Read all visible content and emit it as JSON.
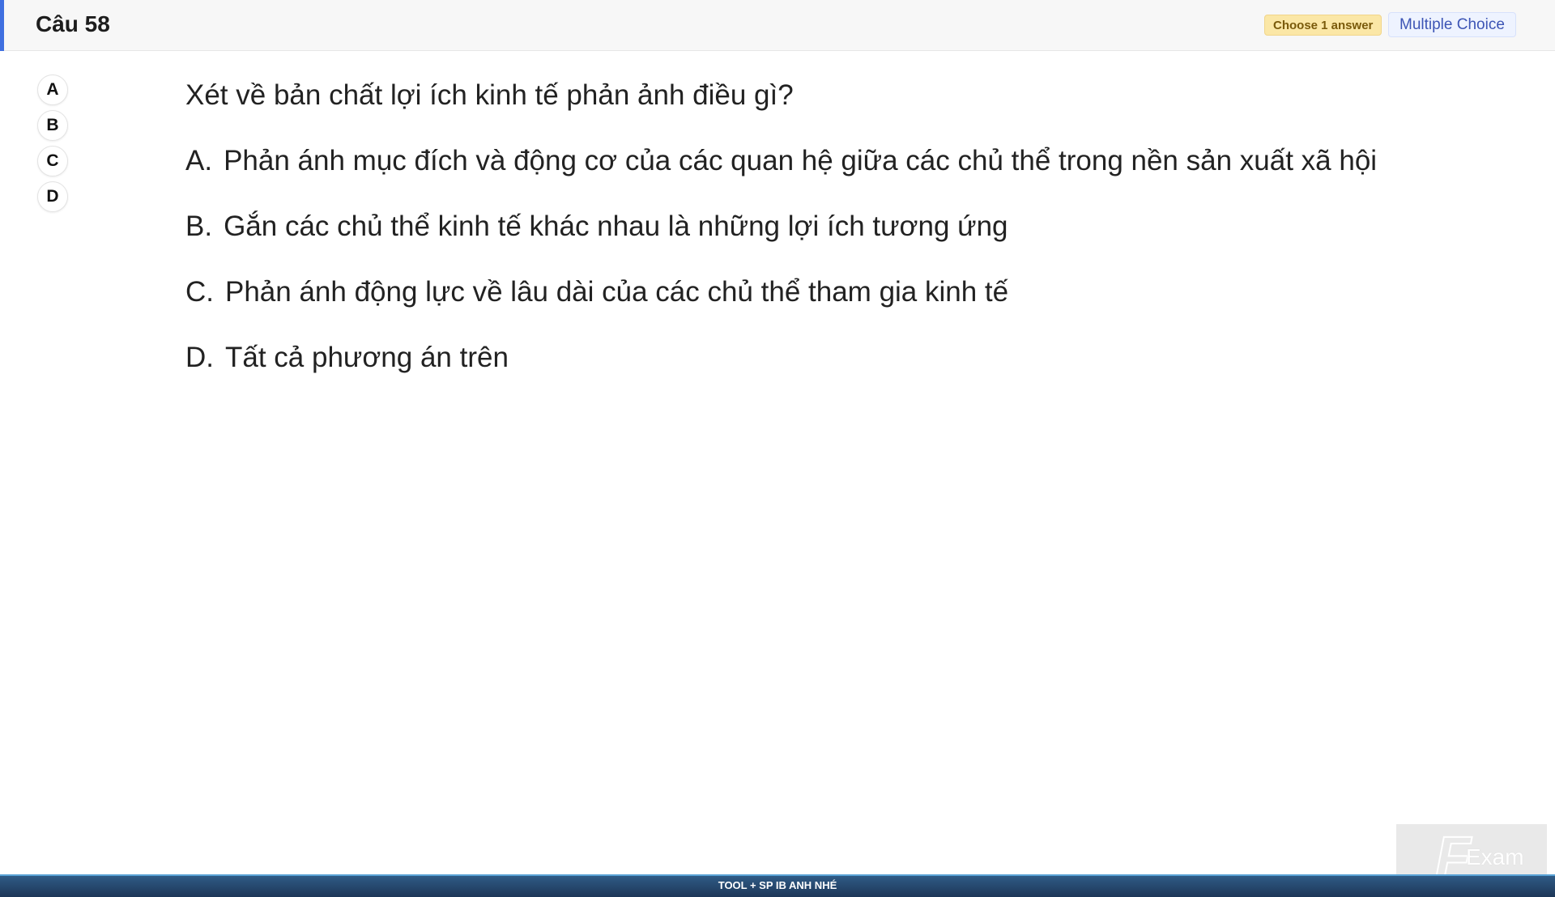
{
  "header": {
    "title": "Câu 58",
    "badge_choose": "Choose 1 answer",
    "badge_type": "Multiple Choice"
  },
  "answer_buttons": [
    "A",
    "B",
    "C",
    "D"
  ],
  "question": {
    "text": "Xét về bản chất lợi ích kinh tế phản ảnh điều gì?",
    "options": [
      {
        "letter": "A.",
        "text": "Phản ánh mục đích và động cơ của các quan hệ giữa các chủ thể trong nền sản xuất xã hội"
      },
      {
        "letter": "B.",
        "text": "Gắn các chủ thể kinh tế khác nhau là những lợi ích tương ứng"
      },
      {
        "letter": "C.",
        "text": "Phản ánh động lực về lâu dài của các chủ thể tham gia kinh tế"
      },
      {
        "letter": "D.",
        "text": "Tất cả phương án trên"
      }
    ]
  },
  "footer": {
    "text": "TOOL + SP IB ANH NHÉ"
  },
  "logo": {
    "letter": "F",
    "word": "Exam"
  },
  "colors": {
    "accent": "#3f6fe0",
    "badge_choose_bg": "#fbe7a6",
    "badge_type_bg": "#eef3ff",
    "footer_bg": "#2f5b86"
  }
}
